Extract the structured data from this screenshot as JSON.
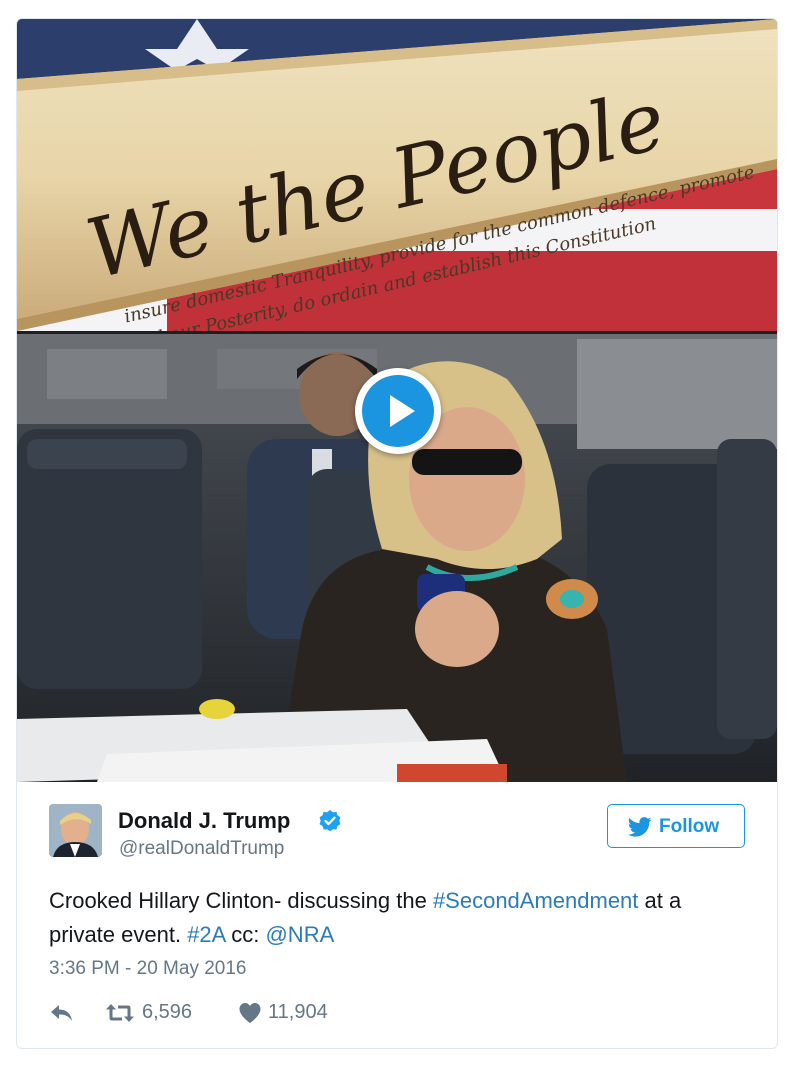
{
  "tweet": {
    "display_name": "Donald J. Trump",
    "handle": "@realDonaldTrump",
    "verified": true,
    "follow_label": "Follow",
    "text": {
      "part1": "Crooked Hillary Clinton- discussing the ",
      "hashtag1": "#SecondAmendment",
      "part2": " at a private event. ",
      "hashtag2": "#2A",
      "part3": " cc: ",
      "mention": "@NRA"
    },
    "timestamp": "3:36 PM - 20 May 2016",
    "actions": {
      "reply_icon": "reply-icon",
      "retweet_icon": "retweet-icon",
      "retweet_count": "6,596",
      "like_icon": "heart-icon",
      "like_count": "11,904"
    }
  },
  "media": {
    "type": "video",
    "play_icon": "play-icon",
    "scroll_text": "We the People"
  },
  "colors": {
    "accent": "#1b95e0",
    "link": "#2b7bb9",
    "text": "#14171a",
    "muted": "#657786",
    "border": "#e1e8ed"
  }
}
